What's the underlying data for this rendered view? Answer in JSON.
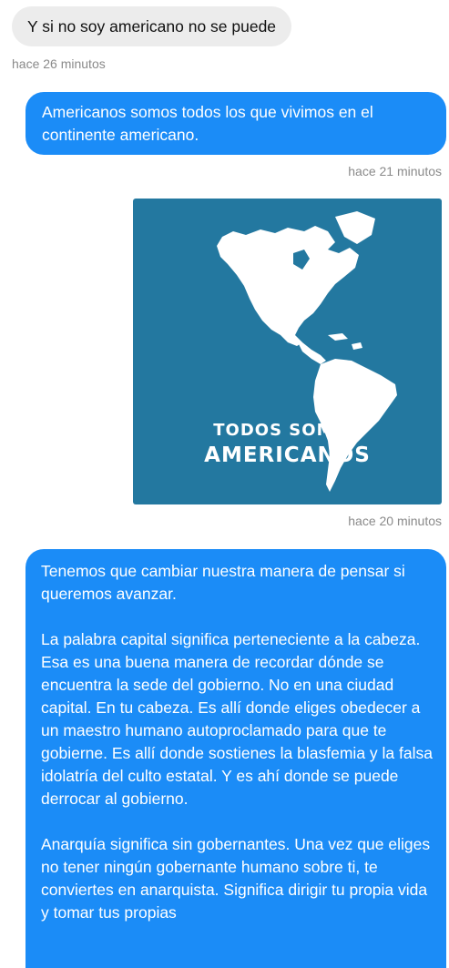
{
  "messages": {
    "incoming_1": {
      "text": "Y si no soy americano no se puede",
      "time": "hace 26 minutos"
    },
    "outgoing_1": {
      "text": "Americanos somos todos los que vivimos en el continente americano.",
      "time": "hace 21 minutos"
    },
    "outgoing_image": {
      "line1": "TODOS SOMOS",
      "line2": "AMERICANOS",
      "time": "hace 20 minutos"
    },
    "outgoing_2": {
      "paragraphs": [
        "Tenemos que cambiar nuestra manera de pensar si queremos avanzar.",
        "La palabra capital significa perteneciente a la cabeza. Esa es una buena manera de recordar dónde se encuentra la sede del gobierno. No en una ciudad capital. En tu cabeza. Es allí donde eliges obedecer a un maestro humano autoproclamado para que te gobierne. Es allí donde sostienes la blasfemia y la falsa idolatría del culto estatal. Y es ahí donde se puede derrocar al gobierno.",
        "Anarquía significa sin gobernantes. Una vez que eliges no tener ningún gobernante humano sobre ti, te conviertes en anarquista. Significa dirigir tu propia vida y tomar tus propias"
      ]
    }
  },
  "colors": {
    "outgoing_bubble": "#1b8cf7",
    "incoming_bubble": "#ececec",
    "timestamp": "#8a8a8a",
    "image_background": "#2378a0"
  },
  "icons": {
    "image_content": "americas-map-icon"
  }
}
